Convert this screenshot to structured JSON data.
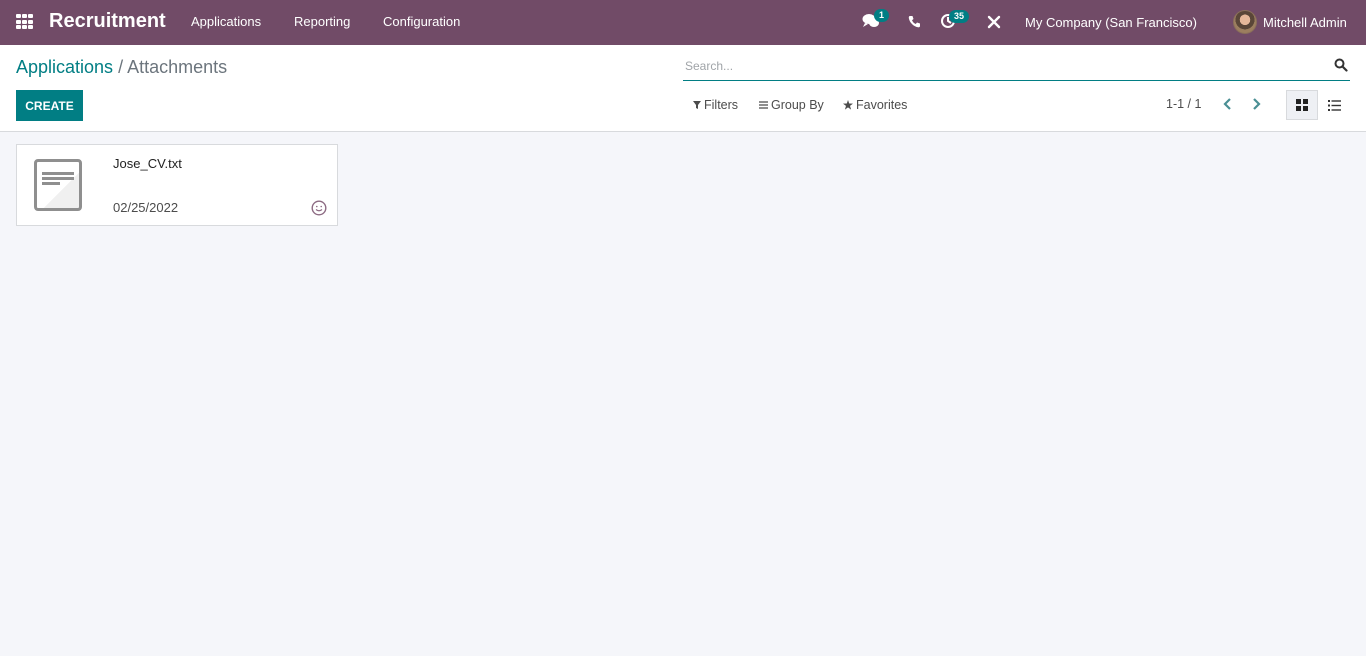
{
  "navbar": {
    "app_title": "Recruitment",
    "menu": [
      "Applications",
      "Reporting",
      "Configuration"
    ],
    "messages_badge": "1",
    "activities_badge": "35",
    "company": "My Company (San Francisco)",
    "user": "Mitchell Admin"
  },
  "breadcrumb": {
    "parent": "Applications",
    "separator": "/",
    "current": "Attachments"
  },
  "toolbar": {
    "create_label": "CREATE",
    "filters_label": "Filters",
    "groupby_label": "Group By",
    "favorites_label": "Favorites",
    "pager": "1-1 / 1"
  },
  "search": {
    "placeholder": "Search...",
    "value": ""
  },
  "records": [
    {
      "name": "Jose_CV.txt",
      "date": "02/25/2022"
    }
  ],
  "colors": {
    "navbar": "#714b67",
    "primary": "#017e84",
    "background": "#f5f6fa"
  }
}
